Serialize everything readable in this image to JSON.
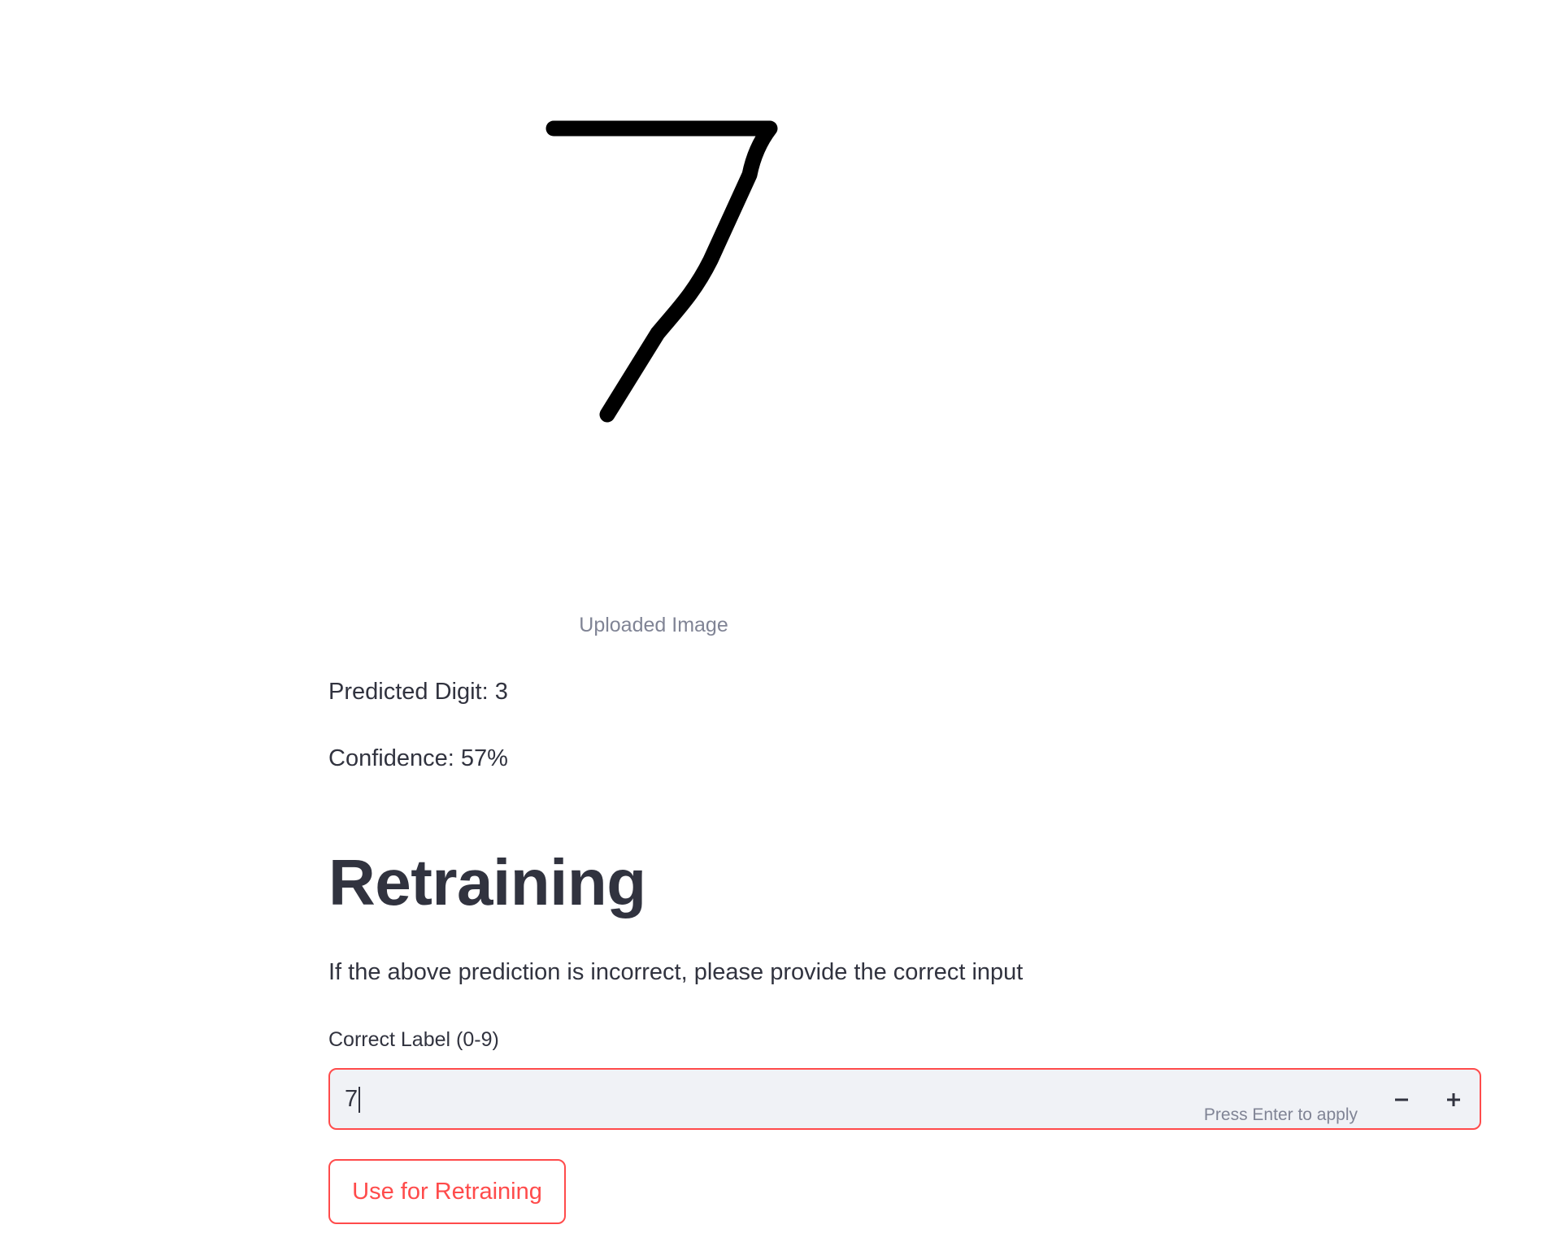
{
  "image_block": {
    "caption": "Uploaded Image",
    "image_alt": "handwritten digit 7"
  },
  "prediction": {
    "digit_text": "Predicted Digit: 3",
    "confidence_text": "Confidence: 57%"
  },
  "retraining": {
    "heading": "Retraining",
    "instruction": "If the above prediction is incorrect, please provide the correct input",
    "label_field": {
      "label": "Correct Label (0-9)",
      "value": "7",
      "hint": "Press Enter to apply"
    },
    "button_label": "Use for Retraining"
  },
  "icons": {
    "decrement": "minus-icon",
    "increment": "plus-icon"
  },
  "colors": {
    "accent": "#ff4b4b",
    "text": "#31333f",
    "muted": "#808495",
    "input_bg": "#f0f2f6"
  }
}
